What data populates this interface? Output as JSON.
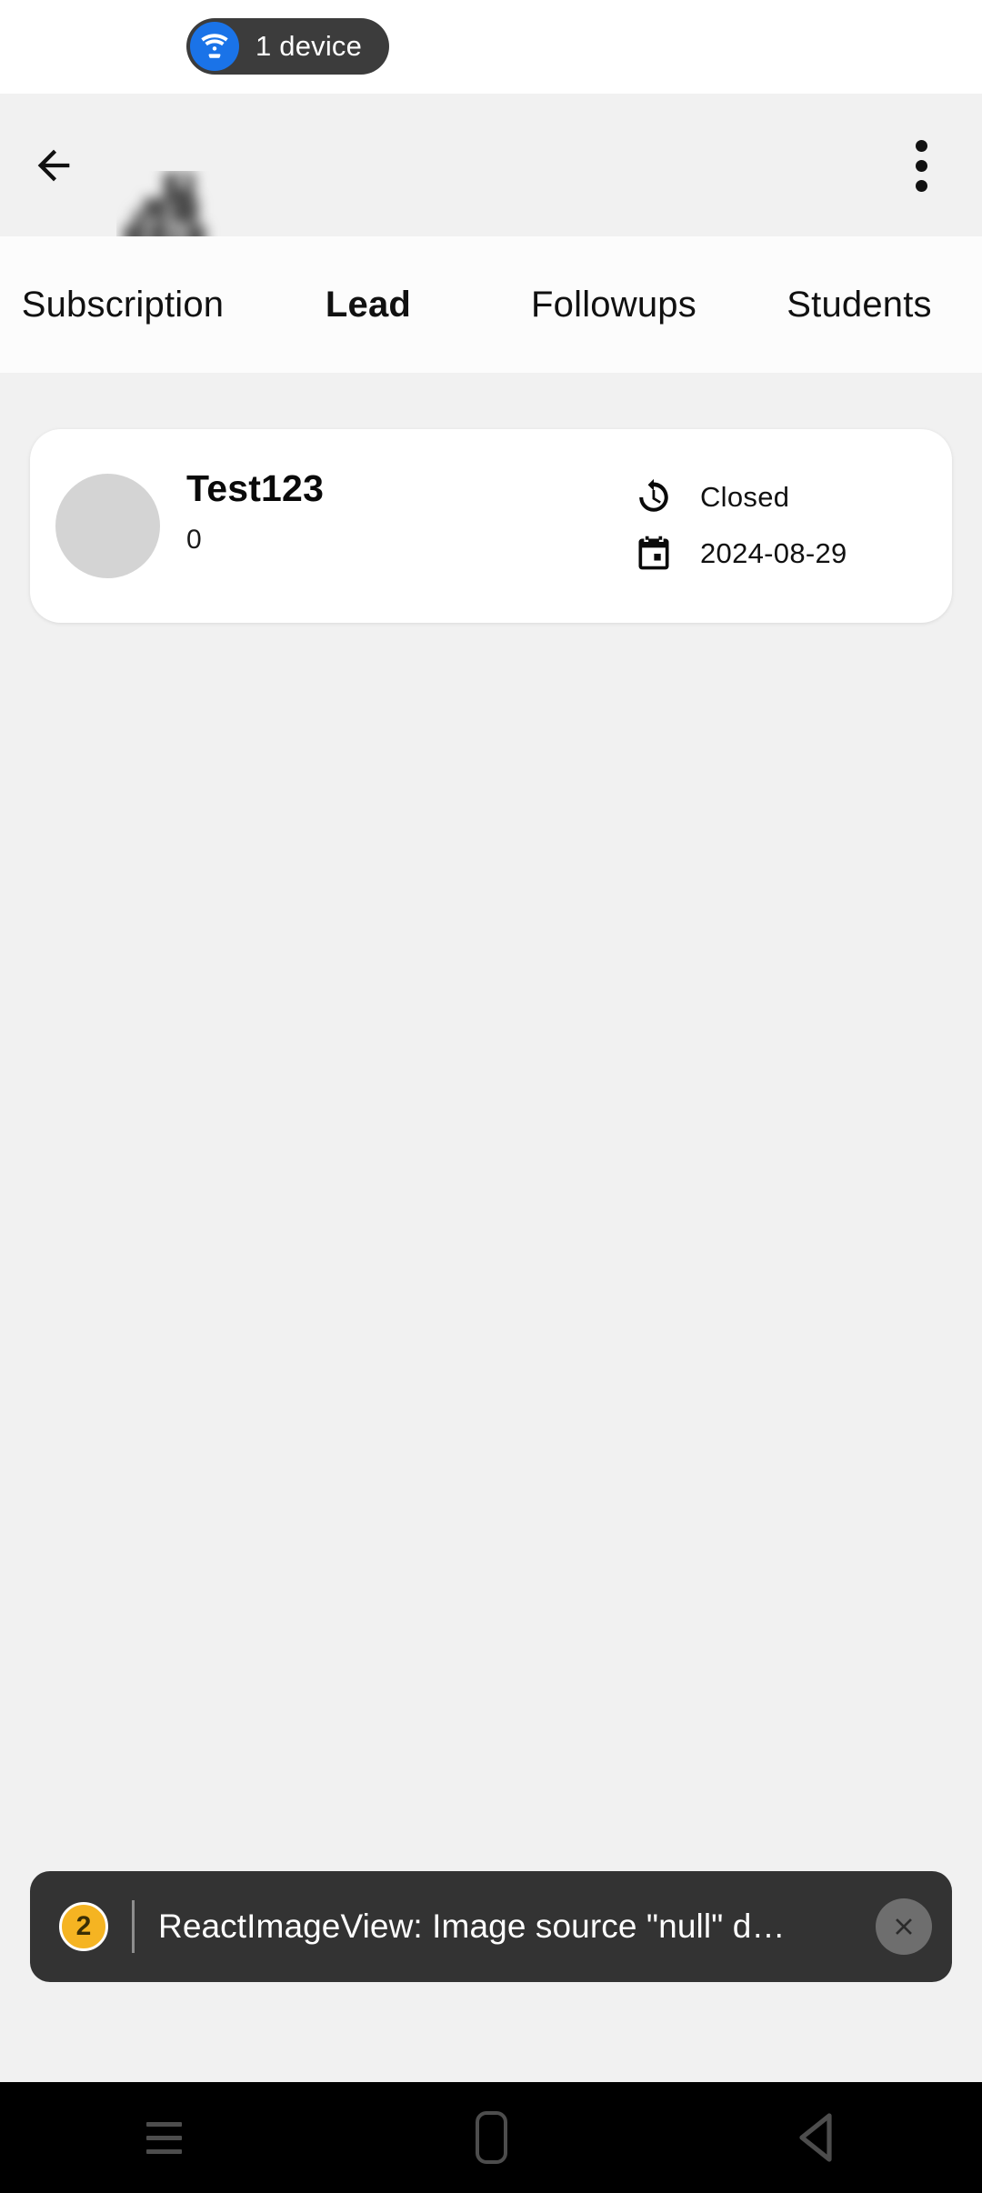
{
  "cast_strip": {
    "icon": "cast-wifi-device-icon",
    "label": "1 device",
    "pill_bg": "#3c3c3c",
    "icon_bg": "#1a73e8"
  },
  "app_bar": {
    "back_icon": "back-arrow-icon",
    "logo_alt": "app-logo-blurred",
    "overflow_icon": "more-vertical-icon",
    "background": "#f1f1f1"
  },
  "tabs": {
    "items": [
      {
        "label": "Subscription",
        "active": false
      },
      {
        "label": "Lead",
        "active": true
      },
      {
        "label": "Followups",
        "active": false
      },
      {
        "label": "Students",
        "active": false
      }
    ]
  },
  "lead_card": {
    "avatar": "avatar-placeholder",
    "name": "Test123",
    "count": "0",
    "status_icon": "update-clock-icon",
    "status": "Closed",
    "date_icon": "calendar-icon",
    "date": "2024-08-29"
  },
  "toast": {
    "count": "2",
    "message": "ReactImageView: Image source \"null\" d…",
    "close_icon": "close-icon",
    "badge_color": "#f5b422",
    "background": "#333333"
  },
  "nav_bar": {
    "recents_icon": "recents-icon",
    "home_icon": "home-icon",
    "back_icon": "back-triangle-icon"
  }
}
